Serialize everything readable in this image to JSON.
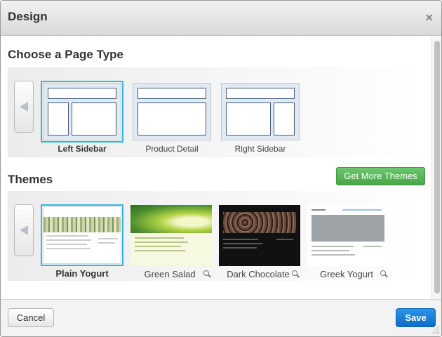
{
  "dialog": {
    "title": "Design",
    "close_glyph": "×"
  },
  "page_type": {
    "heading": "Choose a Page Type",
    "items": [
      {
        "label": "Left Sidebar",
        "selected": true
      },
      {
        "label": "Product Detail",
        "selected": false
      },
      {
        "label": "Right Sidebar",
        "selected": false
      }
    ]
  },
  "themes": {
    "heading": "Themes",
    "get_more_label": "Get More Themes",
    "items": [
      {
        "label": "Plain Yogurt",
        "selected": true
      },
      {
        "label": "Green Salad",
        "selected": false
      },
      {
        "label": "Dark Chocolate",
        "selected": false
      },
      {
        "label": "Greek Yogurt",
        "selected": false
      }
    ]
  },
  "footer": {
    "cancel_label": "Cancel",
    "save_label": "Save"
  },
  "colors": {
    "selection_border": "#37b5e0",
    "get_more_green": "#48a648",
    "save_blue": "#0b6cc9"
  },
  "icons": [
    "close-icon",
    "arrow-left-icon",
    "magnifier-icon",
    "resize-grip-icon"
  ]
}
